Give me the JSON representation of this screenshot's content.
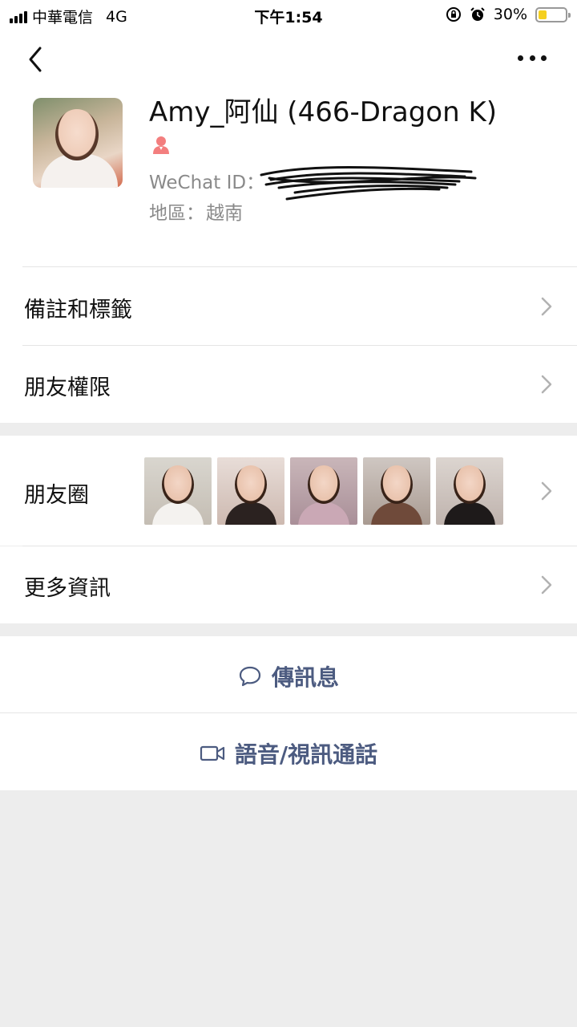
{
  "status_bar": {
    "carrier": "中華電信",
    "network": "4G",
    "time": "下午1:54",
    "battery_percent": "30%",
    "battery_level": 0.3,
    "icons": [
      "signal-icon",
      "orientation-lock-icon",
      "alarm-icon",
      "battery-icon"
    ]
  },
  "nav": {
    "back_icon": "chevron-left-icon",
    "more_icon": "more-dots-icon"
  },
  "profile": {
    "name": "Amy_阿仙 (466-Dragon K)",
    "gender_icon": "female-user-icon",
    "gender_color": "#f37e7e",
    "wechat_id_label": "WeChat ID：",
    "region_label": "地區：",
    "region_value": "越南"
  },
  "menu": {
    "remarks_tags": "備註和標籤",
    "friend_permissions": "朋友權限",
    "moments": "朋友圈",
    "more_info": "更多資訊"
  },
  "actions": {
    "send_message": "傳訊息",
    "voice_video_call": "語音/視訊通話",
    "message_icon": "chat-bubble-icon",
    "video_icon": "video-camera-icon",
    "accent_color": "#4c5b80"
  }
}
